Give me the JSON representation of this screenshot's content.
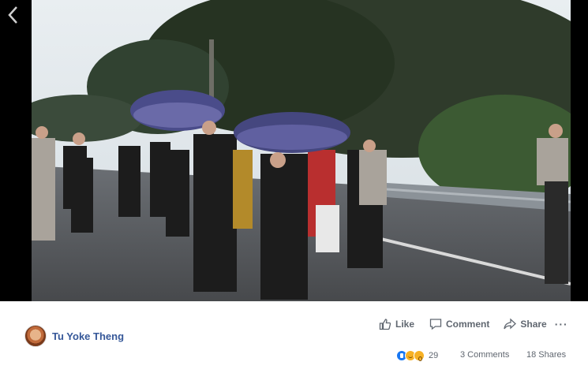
{
  "post": {
    "author_name": "Tu Yoke Theng",
    "avatar_icon": "profile-photo"
  },
  "actions": {
    "like_label": "Like",
    "comment_label": "Comment",
    "share_label": "Share",
    "more_label": "···"
  },
  "stats": {
    "reaction_count": "29",
    "reaction_icons": [
      "like-icon",
      "haha-icon",
      "wow-icon"
    ],
    "comments_label": "3 Comments",
    "shares_label": "18 Shares"
  },
  "colors": {
    "author_link": "#365899",
    "action_text": "#606770",
    "like_blue": "#1877f2",
    "reaction_yellow": "#f7b125"
  }
}
